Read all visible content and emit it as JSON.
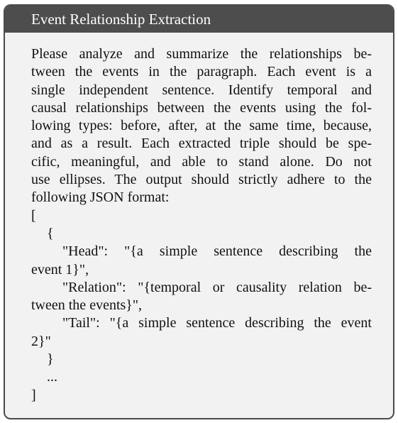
{
  "header": {
    "title": "Event Relationship Extraction"
  },
  "body": {
    "lines": [
      "Please analyze and summarize the relationships be-",
      "tween the events in the paragraph. Each event is a",
      "single independent sentence. Identify temporal and",
      "causal relationships between the events using the fol-",
      "lowing types: before, after, at the same time, because,",
      "and as a result. Each extracted triple should be spe-",
      "cific, meaningful, and able to stand alone. Do not",
      "use ellipses. The output should strictly adhere to the",
      "following JSON format:",
      "[",
      "{",
      "\"Head\": \"{a simple sentence describing the",
      "event 1}\",",
      "\"Relation\": \"{temporal or causality relation be-",
      "tween the events}\",",
      "\"Tail\": \"{a simple sentence describing the event",
      "2}\"",
      "}",
      "...",
      "]"
    ]
  }
}
